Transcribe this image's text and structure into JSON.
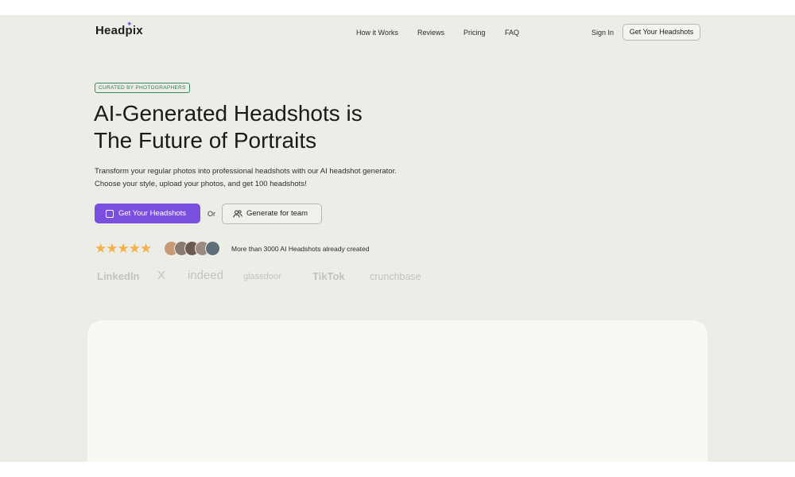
{
  "brand": {
    "name": "Headpix"
  },
  "nav": {
    "items": [
      {
        "label": "How it Works"
      },
      {
        "label": "Reviews"
      },
      {
        "label": "Pricing"
      },
      {
        "label": "FAQ"
      }
    ],
    "sign_in": "Sign In",
    "cta": "Get Your Headshots"
  },
  "hero": {
    "badge": "CURATED BY PHOTOGRAPHERS",
    "title_line1": "AI-Generated Headshots is",
    "title_line2": "The Future of Portraits",
    "desc_line1": "Transform your regular photos into professional headshots with our AI headshot generator.",
    "desc_line2": "Choose your style, upload your photos, and get 100 headshots!",
    "primary_cta": "Get Your Headshots",
    "or_text": "Or",
    "secondary_cta": "Generate for team",
    "stars": "★★★★★",
    "rating": 5,
    "social_proof": "More than 3000 AI Headshots already created"
  },
  "press_logos": [
    "LinkedIn",
    "X",
    "indeed",
    "glassdoor",
    "TikTok",
    "crunchbase"
  ],
  "icons": {
    "primary_cta": "image-icon",
    "secondary_cta": "users-icon",
    "logo_mark": "sparkle-icon"
  },
  "colors": {
    "accent": "#7a4fe0",
    "background": "#edede8",
    "star": "#f2b24a",
    "badge": "#2f7d4f"
  }
}
